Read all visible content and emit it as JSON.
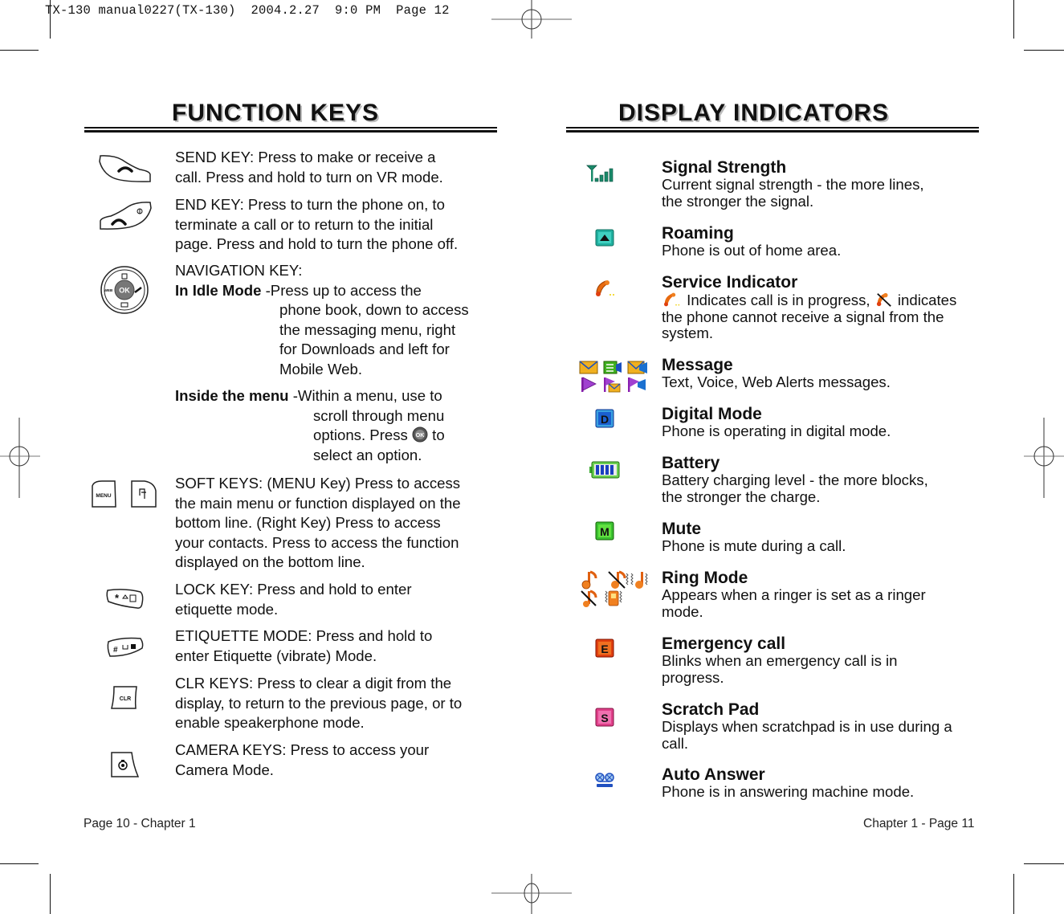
{
  "slug": "TX-130 manual0227(TX-130)  2004.2.27  9:0 PM  Page 12",
  "left_page": {
    "title": "FUNCTION KEYS",
    "items": [
      {
        "icon": "send-key-icon",
        "text": "SEND KEY: Press to make or receive a call. Press and hold to turn on VR mode.",
        "lines": [
          "SEND KEY: Press to make or receive a",
          "call. Press and hold to turn on VR mode."
        ]
      },
      {
        "icon": "end-key-icon",
        "lines": [
          "END KEY: Press to turn the phone on, to",
          "terminate a call or to return to the initial",
          "page. Press and hold to turn the phone off."
        ]
      },
      {
        "icon": "navigation-key-icon",
        "heading": "NAVIGATION KEY:",
        "idle_label": "In Idle Mode",
        "idle_lines": [
          "-Press up to access the",
          "phone book, down to access",
          "the messaging menu, right",
          "for Downloads and left for",
          "Mobile Web."
        ],
        "menu_label": "Inside the menu",
        "menu_lines": [
          "-Within a menu, use to",
          "scroll through menu",
          "options. Press",
          "to",
          "select an option."
        ]
      },
      {
        "icon": "soft-keys-icon",
        "lines": [
          "SOFT KEYS: (MENU Key) Press to access",
          "the main menu or function displayed on the",
          "bottom line. (Right Key) Press to access",
          "your contacts. Press to access the function",
          "displayed on the bottom line."
        ],
        "menu_key_label": "MENU"
      },
      {
        "icon": "lock-key-icon",
        "lines": [
          "LOCK KEY: Press and hold to enter",
          "etiquette mode."
        ]
      },
      {
        "icon": "etiquette-key-icon",
        "lines": [
          "ETIQUETTE MODE: Press and hold to",
          "enter Etiquette (vibrate) Mode."
        ]
      },
      {
        "icon": "clr-key-icon",
        "lines": [
          "CLR KEYS: Press to clear a digit from the",
          "display, to return to the previous page, or to",
          "enable speakerphone mode."
        ],
        "key_label": "CLR"
      },
      {
        "icon": "camera-key-icon",
        "lines": [
          "CAMERA KEYS: Press to access your",
          "Camera Mode."
        ]
      }
    ],
    "footer": "Page 10 - Chapter 1"
  },
  "right_page": {
    "title": "DISPLAY INDICATORS",
    "items": [
      {
        "icon": "signal-strength-icon",
        "title": "Signal Strength",
        "lines": [
          "Current signal strength - the more lines,",
          "the stronger the signal."
        ]
      },
      {
        "icon": "roaming-icon",
        "title": "Roaming",
        "lines": [
          "Phone is out of home area."
        ]
      },
      {
        "icon": "service-indicator-icon",
        "title": "Service Indicator",
        "lines_parts": [
          "Indicates call is in progress,",
          "indicates"
        ],
        "lines": [
          "the phone cannot receive a signal from the",
          "system."
        ]
      },
      {
        "icon": "message-icons",
        "title": "Message",
        "lines": [
          "Text, Voice, Web Alerts messages."
        ]
      },
      {
        "icon": "digital-mode-icon",
        "title": "Digital Mode",
        "lines": [
          "Phone is operating in digital mode."
        ]
      },
      {
        "icon": "battery-icon",
        "title": "Battery",
        "lines": [
          "Battery charging level - the more blocks,",
          "the stronger the charge."
        ]
      },
      {
        "icon": "mute-icon",
        "title": "Mute",
        "lines": [
          "Phone is mute during a call."
        ]
      },
      {
        "icon": "ring-mode-icons",
        "title": "Ring Mode",
        "lines": [
          "Appears when a ringer is set as a ringer",
          "mode."
        ]
      },
      {
        "icon": "emergency-call-icon",
        "title": "Emergency call",
        "lines": [
          "Blinks when an emergency call is in",
          "progress."
        ]
      },
      {
        "icon": "scratch-pad-icon",
        "title": "Scratch Pad",
        "lines": [
          "Displays when scratchpad is in use during a",
          "call."
        ]
      },
      {
        "icon": "auto-answer-icon",
        "title": "Auto Answer",
        "lines": [
          "Phone is in answering machine mode."
        ]
      }
    ],
    "footer": "Chapter 1 - Page 11"
  },
  "icon_glyphs": {
    "ok": "OK",
    "web": "WEB",
    "digital": "D",
    "mute": "M",
    "emergency": "E",
    "scratch": "S"
  },
  "colors": {
    "signal": "#1a8a6a",
    "roaming": "#20b0a0",
    "service": "#e86a10",
    "digital": "#1a5fd0",
    "battery_frame": "#3aaa30",
    "battery_cells": "#1a3fc0",
    "mute": "#3ac030",
    "emergency": "#e04010",
    "scratch": "#e0408a",
    "auto_answer": "#2050c0",
    "message_yellow": "#f0b020",
    "message_purple": "#8a20b0"
  }
}
